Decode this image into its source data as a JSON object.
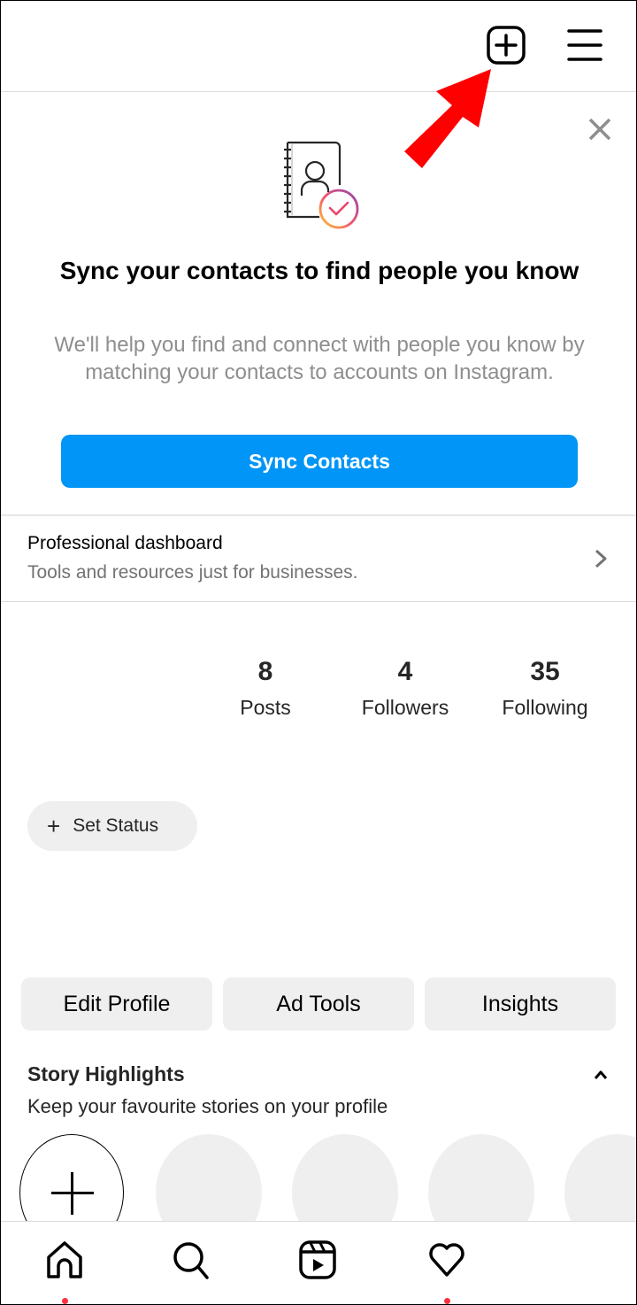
{
  "app": {
    "name": "Instagram"
  },
  "topbar": {
    "new_post_icon": "plus-square-icon",
    "menu_icon": "hamburger-menu-icon"
  },
  "annotation": {
    "arrow_color": "#ff0000",
    "arrow_target": "new-post-button"
  },
  "sync_card": {
    "close_icon": "close-icon",
    "illustration_icon": "contact-book-check-icon",
    "title": "Sync your contacts to find people you know",
    "description": "We'll help you find and connect with people you know by matching your contacts to accounts on Instagram.",
    "button_label": "Sync Contacts",
    "button_color": "#0095f6"
  },
  "dashboard": {
    "title": "Professional dashboard",
    "subtitle": "Tools and resources just for businesses.",
    "chevron_icon": "chevron-right-icon"
  },
  "stats": [
    {
      "value": "8",
      "label": "Posts"
    },
    {
      "value": "4",
      "label": "Followers"
    },
    {
      "value": "35",
      "label": "Following"
    }
  ],
  "status": {
    "plus": "+",
    "label": "Set Status"
  },
  "profile_buttons": [
    {
      "label": "Edit Profile"
    },
    {
      "label": "Ad Tools"
    },
    {
      "label": "Insights"
    }
  ],
  "highlights": {
    "title": "Story Highlights",
    "subtitle": "Keep your favourite stories on your profile",
    "collapse_icon": "chevron-up-icon",
    "new_label_icon": "plus-icon",
    "placeholder_count": 4
  },
  "bottom_nav": {
    "items": [
      {
        "name": "home",
        "icon": "home-icon",
        "badge": true
      },
      {
        "name": "search",
        "icon": "search-icon",
        "badge": false
      },
      {
        "name": "reels",
        "icon": "reels-icon",
        "badge": false
      },
      {
        "name": "activity",
        "icon": "heart-icon",
        "badge": true
      },
      {
        "name": "profile",
        "icon": "profile-avatar",
        "badge": false
      }
    ],
    "badge_color": "#ff3040"
  }
}
